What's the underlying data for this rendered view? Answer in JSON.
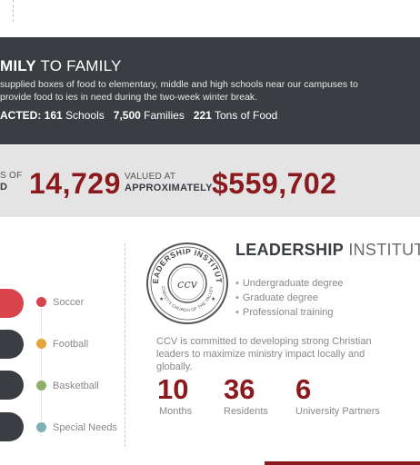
{
  "banner": {
    "title_bold": "MILY",
    "title_rest": "TO FAMILY",
    "description": "supplied boxes of food to elementary, middle and high schools near our campuses to provide food to ies in need during the two-week winter break.",
    "stats_prefix": "ACTED:",
    "stats": [
      {
        "value": "161",
        "label": "Schools"
      },
      {
        "value": "7,500",
        "label": "Families"
      },
      {
        "value": "221",
        "label": "Tons of Food"
      }
    ]
  },
  "band": {
    "label1_line1": "S OF",
    "label1_line2": "D",
    "value1": "14,729",
    "label2_line1": "VALUED AT",
    "label2_line2": "APPROXIMATELY",
    "value2": "$559,702"
  },
  "sports": [
    {
      "label": "Soccer",
      "color": "#d9434b"
    },
    {
      "label": "Football",
      "color": "#e3a43a"
    },
    {
      "label": "Basketball",
      "color": "#8fae6a"
    },
    {
      "label": "Special Needs",
      "color": "#7fb0b6"
    }
  ],
  "leadership": {
    "seal_text_top": "LEADERSHIP INSTITUTE",
    "seal_text_bottom": "CHRIST'S CHURCH OF THE VALLEY",
    "seal_mark": "ccv",
    "title_bold": "LEADERSHIP",
    "title_rest": "INSTITUTE",
    "bullets": [
      "Undergraduate degree",
      "Graduate degree",
      "Professional training"
    ],
    "description": "CCV is committed to developing strong Christian leaders to maximize ministry impact locally and globally.",
    "stats": [
      {
        "value": "10",
        "label": "Months"
      },
      {
        "value": "36",
        "label": "Residents"
      },
      {
        "value": "6",
        "label": "University Partners"
      }
    ]
  },
  "colors": {
    "accent": "#8b1a1e",
    "dark": "#3a3d42",
    "band": "#e4e4e4"
  }
}
